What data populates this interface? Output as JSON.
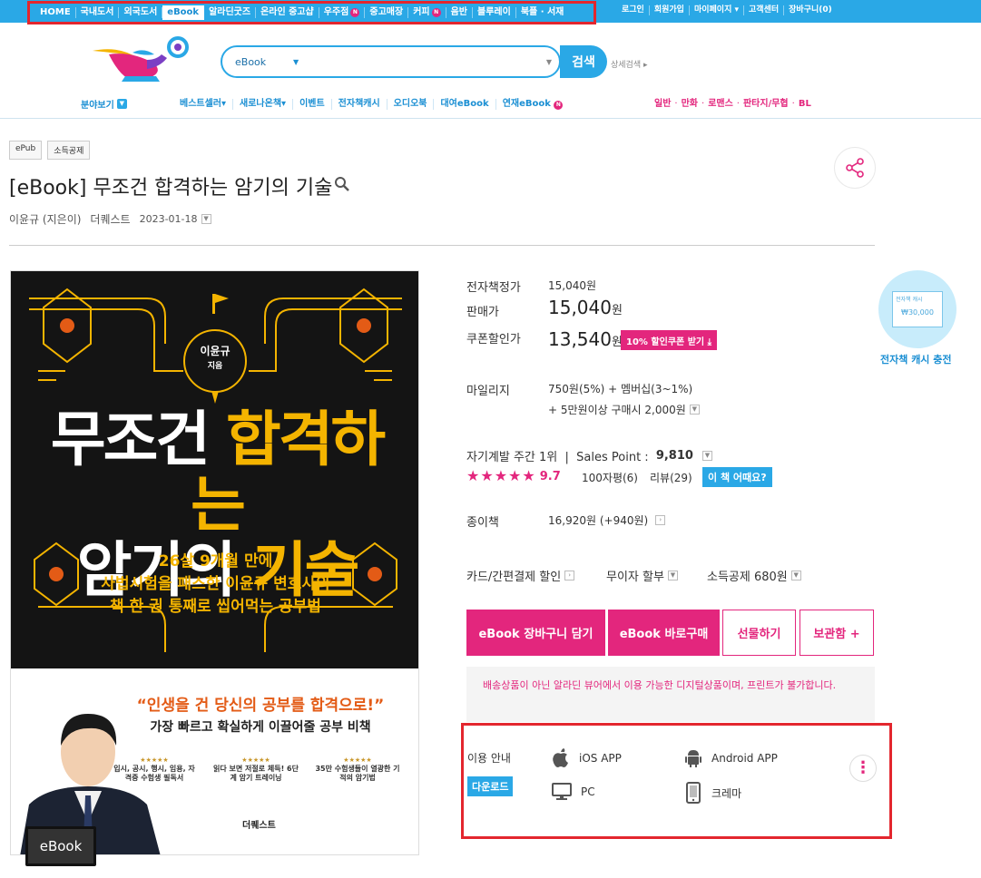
{
  "topnav": {
    "items": [
      "HOME",
      "국내도서",
      "외국도서",
      "eBook",
      "알라딘굿즈",
      "온라인 중고샵",
      "우주점",
      "중고매장",
      "커피",
      "음반",
      "블루레이",
      "북플 · 서재"
    ],
    "active_index": 3,
    "new_badge": "N"
  },
  "util": [
    "로그인",
    "회원가입",
    "마이페이지 ▾",
    "고객센터",
    "장바구니(0)"
  ],
  "search": {
    "category": "eBook",
    "query": "",
    "button": "검색",
    "advanced": "상세검색 ▸"
  },
  "gnb": {
    "category_menu": "분야보기",
    "items": [
      "베스트셀러▾",
      "새로나온책▾",
      "이벤트",
      "전자책캐시",
      "오디오북",
      "대여eBook",
      "연재eBook"
    ],
    "genre": [
      "일반",
      "만화",
      "로맨스",
      "판타지/무협",
      "BL"
    ]
  },
  "product": {
    "tags": [
      "ePub",
      "소득공제"
    ],
    "title": "[eBook] 무조건 합격하는 암기의 기술",
    "author": "이윤규 (지은이)",
    "publisher": "더퀘스트",
    "date": "2023-01-18"
  },
  "cover": {
    "author_name": "이윤규",
    "author_sub": "지음",
    "main_title_line1_a": "무조건 ",
    "main_title_line1_b": "합격하는",
    "main_title_line2_a": "암기의 ",
    "main_title_line2_b": "기술",
    "sub1": "26살 9개월 만에",
    "sub2": "사법시험을 패스한 이윤규 변호사의",
    "sub3": "책 한 권 통째로 씹어먹는 공부법",
    "quote": "“인생을 건 당신의 공부를 합격으로!”",
    "quote2": "가장 빠르고 확실하게 이끌어줄 공부 비책",
    "laurels": [
      "입시, 공시, 행시, 임용, 자격증 수험생 필독서",
      "읽다 보면 저절로 체득! 6단계 암기 트레이닝",
      "35만 수험생들이 열광한 기적의 암기법"
    ],
    "stars": "★★★★★",
    "publisher": "더퀘스트",
    "badge": "eBook"
  },
  "pricing": {
    "list_label": "전자책정가",
    "list_value": "15,040원",
    "sale_label": "판매가",
    "sale_value": "15,040",
    "won": "원",
    "coupon_label": "쿠폰할인가",
    "coupon_value": "13,540",
    "coupon_button": "10% 할인쿠폰 받기 ⤓",
    "mileage_label": "마일리지",
    "mileage_line1": "750원(5%) + 멤버십(3~1%)",
    "mileage_line2": "+ 5만원이상 구매시 2,000원",
    "rank_text": "자기계발 주간 1위  |  Sales Point : ",
    "sales_point": "9,810",
    "rating": 9.7,
    "rating_text": "9.7",
    "review100": "100자평(6)",
    "review": "리뷰(29)",
    "how_button": "이 책 어때요?",
    "paper_label": "종이책",
    "paper_value": "16,920원 (+940원)",
    "card": "카드/간편결제 할인",
    "installment": "무이자 할부",
    "deduction": "소득공제 680원"
  },
  "cash": {
    "card_text": "₩30,000",
    "label": "전자책 캐시 충전",
    "card_title": "전자책 캐시"
  },
  "buttons": {
    "cart": "eBook 장바구니 담기",
    "buy": "eBook 바로구매",
    "gift": "선물하기",
    "keep": "보관함 +"
  },
  "notice": "배송상품이 아닌 알라딘 뷰어에서 이용 가능한 디지털상품이며, 프린트가 불가합니다.",
  "usage": {
    "label": "이용 안내",
    "download": "다운로드",
    "apps": [
      "iOS APP",
      "Android APP",
      "PC",
      "크레마"
    ]
  },
  "colors": {
    "accent_blue": "#2aa8e6",
    "accent_pink": "#e3267d",
    "highlight_red": "#e3262e"
  }
}
